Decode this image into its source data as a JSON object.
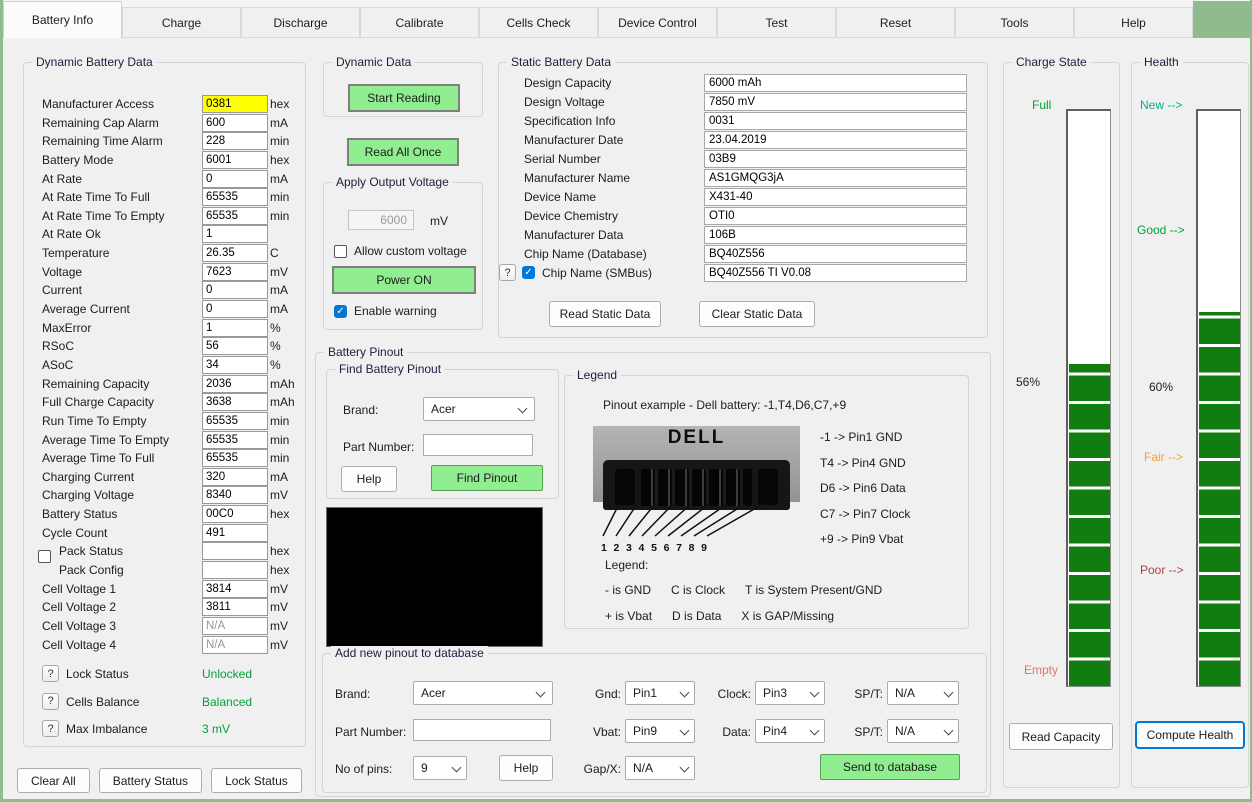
{
  "icons": {
    "help_glyph": "?",
    "check_glyph": "✓"
  },
  "colors": {
    "button_green": "#90ee90",
    "gauge_green": "#117d11",
    "highlight_yellow": "#ffff00",
    "tab_strip_green": "#8fbc8f",
    "status_green": "#00a03c",
    "checkbox_blue": "#0078d7",
    "full_label": "#00a03c",
    "empty_label": "#dd7373",
    "new_label": "#00b294",
    "good_label": "#00a03c",
    "fair_label": "#f0a330",
    "poor_label": "#a94442"
  },
  "tabs": {
    "items": [
      {
        "label": "Battery Info",
        "cls": "active"
      },
      {
        "label": "Charge",
        "cls": ""
      },
      {
        "label": "Discharge",
        "cls": ""
      },
      {
        "label": "Calibrate",
        "cls": ""
      },
      {
        "label": "Cells Check",
        "cls": ""
      },
      {
        "label": "Device Control",
        "cls": ""
      },
      {
        "label": "Test",
        "cls": ""
      },
      {
        "label": "Reset",
        "cls": ""
      },
      {
        "label": "Tools",
        "cls": ""
      },
      {
        "label": "Help",
        "cls": ""
      }
    ]
  },
  "dynamic_panel": {
    "title": "Dynamic Battery Data",
    "rows": [
      {
        "label": "Manufacturer Access",
        "value": "0381",
        "unit": "hex",
        "value_cls": "hl"
      },
      {
        "label": "Remaining Cap Alarm",
        "value": "600",
        "unit": "mA"
      },
      {
        "label": "Remaining Time Alarm",
        "value": "228",
        "unit": "min"
      },
      {
        "label": "Battery Mode",
        "value": "6001",
        "unit": "hex"
      },
      {
        "label": "At Rate",
        "value": "0",
        "unit": "mA"
      },
      {
        "label": "At Rate Time To Full",
        "value": "65535",
        "unit": "min"
      },
      {
        "label": "At Rate Time To Empty",
        "value": "65535",
        "unit": "min"
      },
      {
        "label": "At Rate Ok",
        "value": "1",
        "unit": ""
      },
      {
        "label": "Temperature",
        "value": "26.35",
        "unit": "C"
      },
      {
        "label": "Voltage",
        "value": "7623",
        "unit": "mV"
      },
      {
        "label": "Current",
        "value": "0",
        "unit": "mA"
      },
      {
        "label": "Average Current",
        "value": "0",
        "unit": "mA"
      },
      {
        "label": "MaxError",
        "value": "1",
        "unit": "%"
      },
      {
        "label": "RSoC",
        "value": "56",
        "unit": "%"
      },
      {
        "label": "ASoC",
        "value": "34",
        "unit": "%"
      },
      {
        "label": "Remaining Capacity",
        "value": "2036",
        "unit": "mAh"
      },
      {
        "label": "Full Charge Capacity",
        "value": "3638",
        "unit": "mAh"
      },
      {
        "label": "Run Time To Empty",
        "value": "65535",
        "unit": "min"
      },
      {
        "label": "Average Time To Empty",
        "value": "65535",
        "unit": "min"
      },
      {
        "label": "Average Time To Full",
        "value": "65535",
        "unit": "min"
      },
      {
        "label": "Charging Current",
        "value": "320",
        "unit": "mA"
      },
      {
        "label": "Charging Voltage",
        "value": "8340",
        "unit": "mV"
      },
      {
        "label": "Battery Status",
        "value": "00C0",
        "unit": "hex"
      },
      {
        "label": "Cycle Count",
        "value": "491",
        "unit": ""
      },
      {
        "label": "Pack Status",
        "value": "",
        "unit": "hex",
        "label_cls": "ind",
        "pre_cls": "show"
      },
      {
        "label": "Pack Config",
        "value": "",
        "unit": "hex",
        "label_cls": "ind"
      },
      {
        "label": "Cell Voltage 1",
        "value": "3814",
        "unit": "mV"
      },
      {
        "label": "Cell Voltage 2",
        "value": "3811",
        "unit": "mV"
      },
      {
        "label": "Cell Voltage 3",
        "value": "N/A",
        "unit": "mV",
        "value_cls": "dis"
      },
      {
        "label": "Cell Voltage 4",
        "value": "N/A",
        "unit": "mV",
        "value_cls": "dis"
      }
    ],
    "status_rows": [
      {
        "label": "Lock Status",
        "value": "Unlocked"
      },
      {
        "label": "Cells Balance",
        "value": "Balanced"
      },
      {
        "label": "Max Imbalance",
        "value": "3 mV"
      }
    ],
    "buttons": [
      "Clear All",
      "Battery Status",
      "Lock Status"
    ]
  },
  "dynamic_data_group": {
    "title": "Dynamic Data",
    "start_button": "Start Reading",
    "read_all_button": "Read All Once"
  },
  "apply_voltage_group": {
    "title": "Apply Output Voltage",
    "voltage_value": "6000",
    "voltage_unit": "mV",
    "allow_custom_label": "Allow custom voltage",
    "power_button": "Power ON",
    "enable_warning_label": "Enable warning"
  },
  "static_panel": {
    "title": "Static Battery Data",
    "rows": [
      {
        "label": "Design Capacity",
        "value": "6000 mAh"
      },
      {
        "label": "Design Voltage",
        "value": "7850 mV"
      },
      {
        "label": "Specification Info",
        "value": "0031"
      },
      {
        "label": "Manufacturer Date",
        "value": "23.04.2019"
      },
      {
        "label": "Serial Number",
        "value": "03B9"
      },
      {
        "label": "Manufacturer Name",
        "value": "AS1GMQG3jA"
      },
      {
        "label": "Device Name",
        "value": "X431-40"
      },
      {
        "label": "Device Chemistry",
        "value": "OTI0"
      },
      {
        "label": "Manufacturer Data",
        "value": "106B"
      },
      {
        "label": "Chip Name (Database)",
        "value": "BQ40Z556"
      },
      {
        "label": "Chip Name (SMBus)",
        "value": "BQ40Z556 TI V0.08",
        "pre_cls": "show",
        "label_cls": "shift"
      }
    ],
    "read_button": "Read Static Data",
    "clear_button": "Clear Static Data"
  },
  "battery_pinout": {
    "title": "Battery Pinout",
    "find_group": {
      "title": "Find Battery Pinout",
      "brand_label": "Brand:",
      "brand_value": "Acer",
      "part_label": "Part Number:",
      "part_value": "",
      "help_button": "Help",
      "find_button": "Find Pinout"
    },
    "legend_group": {
      "title": "Legend",
      "example_line": "Pinout example - Dell battery:  -1,T4,D6,C7,+9",
      "connector_brand": "DELL",
      "pin_numbers": [
        "1",
        "2",
        "3",
        "4",
        "5",
        "6",
        "7",
        "8",
        "9"
      ],
      "mappings": [
        "-1 -> Pin1 GND",
        "T4 -> Pin4 GND",
        "D6 -> Pin6 Data",
        "C7 -> Pin7 Clock",
        "+9 -> Pin9 Vbat"
      ],
      "legend_label": "Legend:",
      "legend_line1": [
        "- is GND",
        "C is Clock",
        "T is System Present/GND"
      ],
      "legend_line2": [
        "+ is Vbat",
        "D is Data",
        "X is GAP/Missing"
      ]
    },
    "add_group": {
      "title": "Add new pinout to database",
      "brand_label": "Brand:",
      "brand_value": "Acer",
      "part_label": "Part Number:",
      "part_value": "",
      "pins_label": "No of pins:",
      "pins_value": "9",
      "help_button": "Help",
      "gnd_label": "Gnd:",
      "gnd_value": "Pin1",
      "vbat_label": "Vbat:",
      "vbat_value": "Pin9",
      "gapx_label": "Gap/X:",
      "gapx_value": "N/A",
      "clock_label": "Clock:",
      "clock_value": "Pin3",
      "data_label": "Data:",
      "data_value": "Pin4",
      "spt1_label": "SP/T:",
      "spt1_value": "N/A",
      "spt2_label": "SP/T:",
      "spt2_value": "N/A",
      "send_button": "Send to database"
    }
  },
  "charge_state": {
    "title": "Charge State",
    "top_label": "Full",
    "percent_label": "56%",
    "bottom_label": "Empty",
    "button": "Read Capacity",
    "fill_percent": 56
  },
  "health": {
    "title": "Health",
    "new_label": "New -->",
    "good_label": "Good -->",
    "fair_label": "Fair -->",
    "poor_label": "Poor -->",
    "percent_label": "60%",
    "button": "Compute Health",
    "fill_percent": 65
  }
}
